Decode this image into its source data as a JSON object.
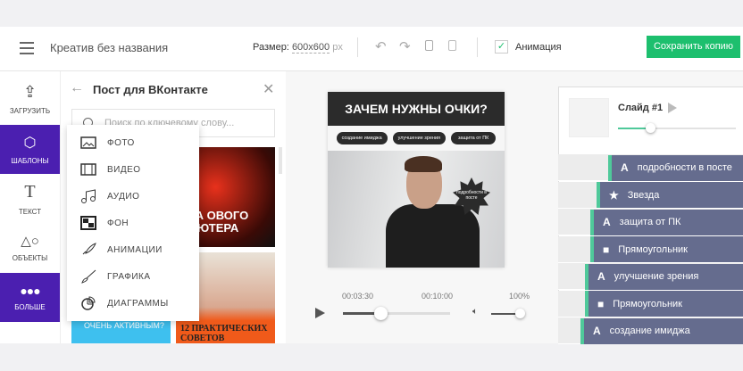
{
  "header": {
    "title": "Креатив без названия",
    "size_label": "Размер:",
    "size_value": "600x600",
    "size_unit": "px",
    "animation_label": "Анимация",
    "animation_checked": true,
    "save_button": "Сохранить копию",
    "accent": "#1dbf6e"
  },
  "rail": [
    {
      "label": "ЗАГРУЗИТЬ",
      "icon": "upload-icon"
    },
    {
      "label": "ШАБЛОНЫ",
      "icon": "cubes-icon",
      "active": true
    },
    {
      "label": "ТЕКСТ",
      "icon": "text-icon"
    },
    {
      "label": "ОБЪЕКТЫ",
      "icon": "shapes-icon"
    },
    {
      "label": "БОЛЬШЕ",
      "icon": "more-icon",
      "active": true
    }
  ],
  "panel": {
    "title": "Пост для ВКонтакте",
    "search_placeholder": "Поиск по ключевому слову...",
    "thumbs": [
      "РКА ОВОГО ПЬЮТЕРА",
      "ОЧЕНЬ АКТИВНЫМ?",
      "12 ПРАКТИЧЕСКИХ СОВЕТОВ"
    ]
  },
  "menu": [
    "ФОТО",
    "ВИДЕО",
    "АУДИО",
    "ФОН",
    "АНИМАЦИИ",
    "ГРАФИКА",
    "ДИАГРАММЫ"
  ],
  "canvas": {
    "title": "ЗАЧЕМ НУЖНЫ ОЧКИ?",
    "tags": [
      "создание имиджа",
      "улучшение зрения",
      "защита от ПК"
    ],
    "star_text": "подробности в посте"
  },
  "player": {
    "current": "00:03:30",
    "total": "00:10:00",
    "progress": 0.35,
    "volume_label": "100%",
    "volume": 1.0
  },
  "timeline": {
    "slide_label": "Слайд #1",
    "slide_progress": 0.28,
    "layers": [
      {
        "icon": "A",
        "label": "подробности в посте"
      },
      {
        "icon": "★",
        "label": "Звезда"
      },
      {
        "icon": "A",
        "label": "защита от ПК"
      },
      {
        "icon": "■",
        "label": "Прямоугольник"
      },
      {
        "icon": "A",
        "label": "улучшение зрения"
      },
      {
        "icon": "■",
        "label": "Прямоугольник"
      },
      {
        "icon": "A",
        "label": "создание имиджа"
      }
    ]
  }
}
